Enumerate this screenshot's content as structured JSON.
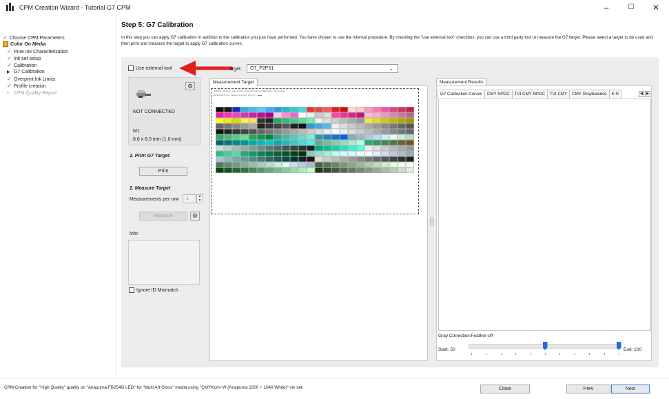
{
  "window": {
    "title": "CPM Creation Wizard - Tutorial G7 CPM",
    "minimize_label": "–",
    "maximize_label": "☐",
    "close_label": "✕"
  },
  "steps": [
    {
      "label": "Choose CPM Parameters",
      "mark": "✓",
      "state": "done",
      "indent": 0
    },
    {
      "label": "Color On Media",
      "mark": "!",
      "state": "group",
      "indent": 0
    },
    {
      "label": "Pure Ink Characterization",
      "mark": "✓",
      "state": "done",
      "indent": 1
    },
    {
      "label": "Ink set setup",
      "mark": "✓",
      "state": "done",
      "indent": 1
    },
    {
      "label": "Calibration",
      "mark": "✓",
      "state": "done",
      "indent": 1
    },
    {
      "label": "G7 Calibration",
      "mark": "▶",
      "state": "current",
      "indent": 1
    },
    {
      "label": "Overprint Ink Limits",
      "mark": "✓",
      "state": "done",
      "indent": 1
    },
    {
      "label": "Profile creation",
      "mark": "✓",
      "state": "done",
      "indent": 1
    },
    {
      "label": "CPM Quality Report",
      "mark": "•",
      "state": "pending",
      "indent": 1
    }
  ],
  "header": {
    "title": "Step 5: G7 Calibration",
    "description": "In this step you can apply G7 calibration in addition to the calibration you just have performed. You have chosen to use the internal procedure. By checking the \"use external tool\" checkbox, you can use a third party tool to measure the G7 target. Please select a target to be used and then print and measure the target to apply G7 calibration curves."
  },
  "left_panel": {
    "external_tool_label": "Use external tool",
    "external_tool_checked": false,
    "device_status": "NOT CONNECTED",
    "device_mode": "M1",
    "device_aperture": "8.0 x 8.0 mm (1.0 mm)",
    "print_section": "1. Print G7 Target",
    "print_button": "Print",
    "measure_section": "2. Measure Target",
    "measurements_per_row_label": "Measurements per row",
    "measurements_per_row_value": "1",
    "measure_button": "Measure",
    "info_label": "Info:",
    "ignore_id_label": "Ignore ID Mismatch",
    "ignore_id_checked": false
  },
  "target": {
    "label": "Target:",
    "visible_label": "arget:",
    "value": "G7_P2P51",
    "tab_label": "Measurement Target",
    "header_line_1": "G7/P2P51 · CMYK+W · target id 2041 · printed with Anapurna FB2540i LED · Multi Art Gloss",
    "header_line_2": "Patch layout 22 x 12 · measure left to right · strip 1 of 1 · ■■■■"
  },
  "results": {
    "panel_label": "Measurement Results",
    "tabs": [
      "G7 Calibration Curves",
      "CMY NPDC",
      "TVI CMY NPDC",
      "TVI CMY",
      "CMY Graybalance",
      "K N"
    ],
    "active_tab": 0,
    "feather_label": "Gray Correction Feather-off",
    "start_label": "Start: 50",
    "end_label": "End: 100",
    "start_value": 50,
    "end_value": 100
  },
  "footer": {
    "status": "CPM Creation for \"High Quality\" quality on \"Anapurna FB2540i LED\" for \"Multi Art Gloss\" media using \"CMYKcm+W (Anapurna 1500 + 1040 White)\" ink set.",
    "close_button": "Close",
    "prev_button": "Prev",
    "next_button": "Next"
  },
  "colors": {
    "accent": "#1f6fd6",
    "check_green": "#2a8a2a",
    "annotation_red": "#e02020",
    "group_badge": "#e8a21c"
  }
}
